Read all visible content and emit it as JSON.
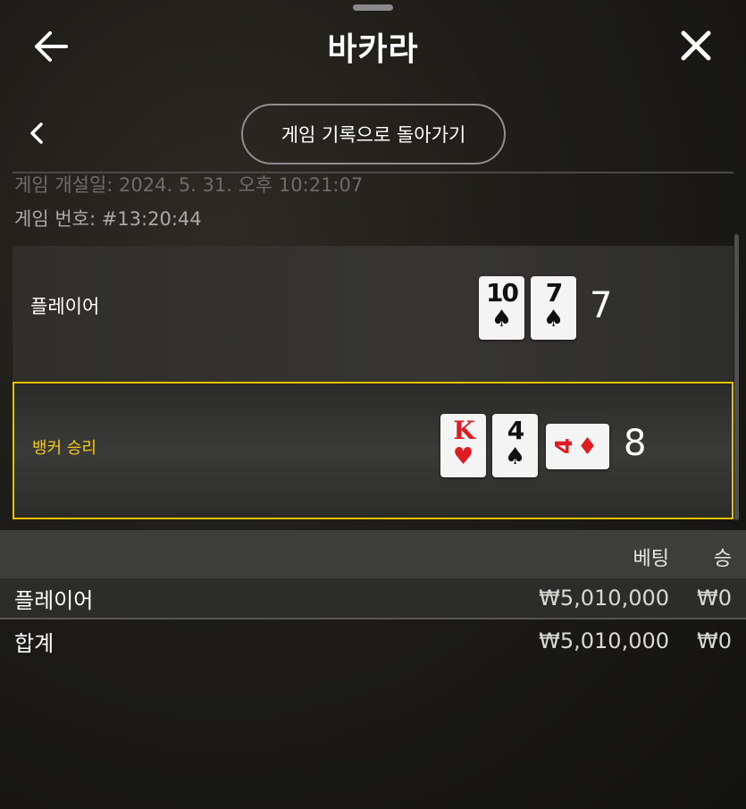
{
  "header": {
    "title": "바카라"
  },
  "nav": {
    "back_to_history_label": "게임 기록으로 돌아가기"
  },
  "game": {
    "time_text": "게임 개설일: 2024. 5. 31. 오후 10:21:07",
    "number_text": "게임 번호: #13:20:44"
  },
  "hands": {
    "player": {
      "label": "플레이어",
      "score": "7",
      "cards": [
        {
          "rank": "10",
          "suit": "♠",
          "color": "black"
        },
        {
          "rank": "7",
          "suit": "♠",
          "color": "black"
        }
      ]
    },
    "banker": {
      "label": "뱅커 승리",
      "score": "8",
      "highlight_color": "#e7c100",
      "cards": [
        {
          "rank": "K",
          "suit": "♥",
          "color": "red"
        },
        {
          "rank": "4",
          "suit": "♠",
          "color": "black"
        },
        {
          "rank": "4",
          "suit": "♦",
          "color": "red",
          "orientation": "rotated"
        }
      ]
    }
  },
  "bets": {
    "columns": {
      "bet": "베팅",
      "win": "승"
    },
    "rows": [
      {
        "label": "플레이어",
        "bet": "₩5,010,000",
        "win": "₩0"
      },
      {
        "label": "합계",
        "bet": "₩5,010,000",
        "win": "₩0"
      }
    ]
  }
}
